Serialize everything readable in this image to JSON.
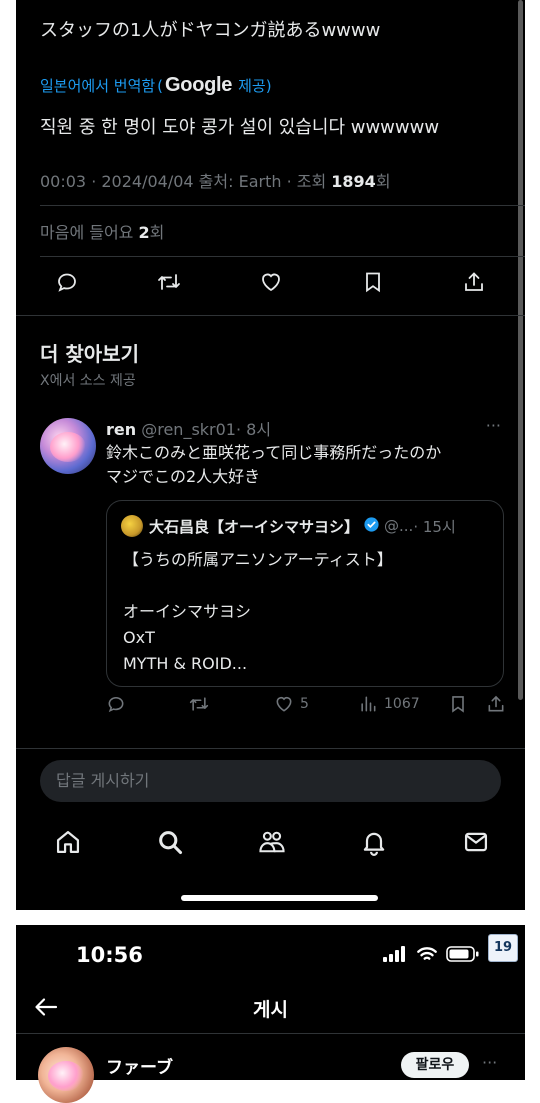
{
  "tweet": {
    "original_text": "スタッフの1人がドヤコンガ説あるwwww",
    "translation_label": "일본어에서 번역함",
    "translation_provider": "Google",
    "translation_suffix": "제공)",
    "translated_text": "직원 중 한 명이 도야 콩가 설이 있습니다 wwwwww",
    "meta_prefix": "00:03 · 2024/04/04 출처: Earth · 조회 ",
    "views": "1894",
    "views_suffix": "회",
    "likes_prefix": "마음에 들어요 ",
    "likes_count": "2",
    "likes_suffix": "회",
    "action_icons": [
      "reply-icon",
      "retweet-icon",
      "like-icon",
      "bookmark-icon",
      "share-icon"
    ]
  },
  "discover": {
    "title": "더 찾아보기",
    "subtitle": "X에서 소스 제공"
  },
  "reply": {
    "author": "ren",
    "handle": "@ren_skr01",
    "time": "· 8시",
    "line1": "鈴木このみと亜咲花って同じ事務所だったのか",
    "line2": "マジでこの2人大好き",
    "more": "···",
    "quote": {
      "author": "大石昌良【オーイシマサヨシ】",
      "handle": "@...",
      "time": "· 15시",
      "lines": [
        "【うちの所属アニソンアーティスト】",
        "",
        "オーイシマサヨシ",
        "OxT",
        "MYTH & ROID..."
      ]
    },
    "likes": "5",
    "views": "1067"
  },
  "composer": {
    "placeholder": "답글 게시하기"
  },
  "tabbar": {
    "icons": [
      "home-icon",
      "search-icon",
      "communities-icon",
      "notifications-icon",
      "messages-icon"
    ]
  },
  "screen2": {
    "time": "10:56",
    "title": "게시",
    "badge": "19",
    "user": "ファーブ",
    "follow": "팔로우",
    "more": "···"
  },
  "colors": {
    "background": "#000000",
    "text": "#e7e9ea",
    "muted": "#71767b",
    "accent": "#1d9bf0",
    "divider": "#2f3336"
  }
}
